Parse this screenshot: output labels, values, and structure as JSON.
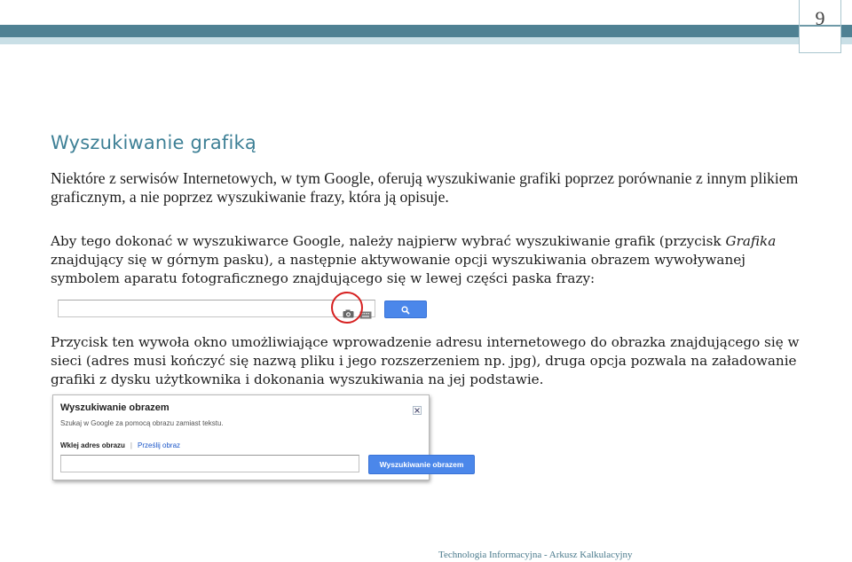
{
  "page": {
    "number": "9",
    "title": "Wyszukiwanie grafiką",
    "footer": "Technologia Informacyjna - Arkusz Kalkulacyjny"
  },
  "paragraphs": {
    "p1": "Niektóre z serwisów Internetowych, w tym Google, oferują wyszukiwanie grafiki poprzez porównanie z innym plikiem graficznym, a nie poprzez wyszukiwanie frazy, która ją opisuje.",
    "p2_before": "Aby tego dokonać w wyszukiwarce Google, należy najpierw wybrać wyszukiwanie grafik (przycisk ",
    "p2_italic": "Grafika",
    "p2_after": " znajdujący się w górnym pasku), a następnie aktywowanie opcji wyszukiwania obrazem wywoływanej symbolem aparatu fotograficznego znajdującego się w lewej części paska frazy:",
    "p3": "Przycisk ten wywoła okno umożliwiające wprowadzenie adresu internetowego do obrazka znajdującego się w sieci (adres musi kończyć się nazwą pliku i jego rozszerzeniem np. jpg), druga opcja pozwala na załadowanie grafiki z dysku użytkownika i dokonania wyszukiwania na jej podstawie."
  },
  "searchbar": {
    "value": "",
    "icons": [
      "camera-icon",
      "keyboard-icon",
      "search-icon"
    ]
  },
  "dialog": {
    "title": "Wyszukiwanie obrazem",
    "subtitle": "Szukaj w Google za pomocą obrazu zamiast tekstu.",
    "tab_active": "Wklej adres obrazu",
    "tab_separator": "|",
    "tab_inactive": "Prześlij obraz",
    "input_value": "",
    "button_label": "Wyszukiwanie obrazem"
  },
  "colors": {
    "accent": "#3e8096",
    "band": "#4f8193",
    "button_blue": "#4b87ea",
    "highlight_circle": "#d62020"
  }
}
